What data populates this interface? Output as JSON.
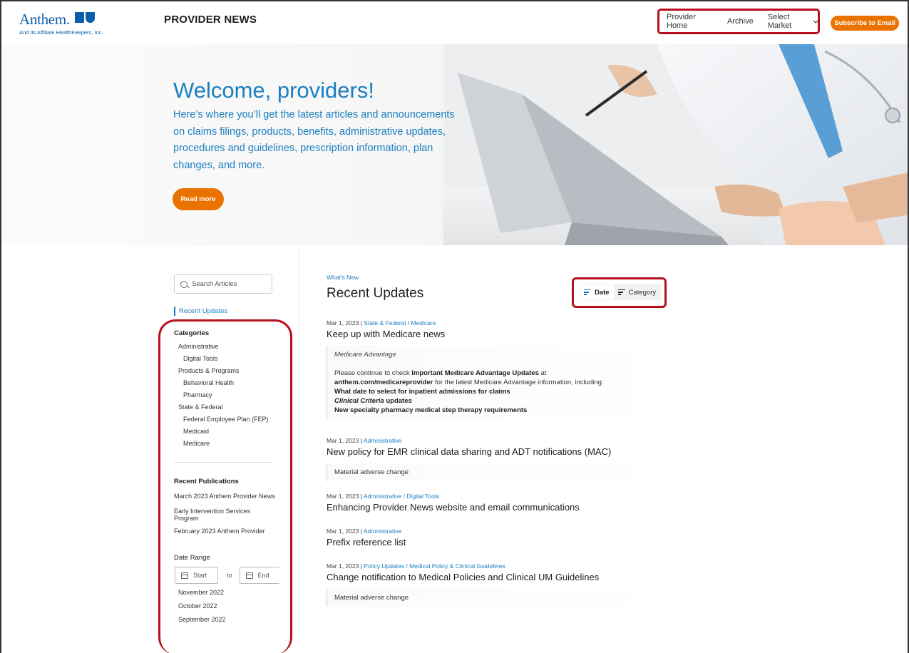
{
  "header": {
    "logo_word": "Anthem.",
    "logo_sub": "And Its Affiliate HealthKeepers, Inc.",
    "site_title": "PROVIDER NEWS",
    "nav": {
      "provider_home": "Provider Home",
      "archive": "Archive",
      "select_market": "Select Market"
    },
    "subscribe_label": "Subscribe to Email"
  },
  "hero": {
    "title": "Welcome, providers!",
    "text": "Here’s where you’ll get the latest articles and announcements on claims filings, products, benefits, administrative updates, procedures and guidelines, prescription information, plan changes, and more.",
    "read_more_label": "Read more"
  },
  "sidebar": {
    "search_placeholder": "Search Articles",
    "recent_updates_label": "Recent Updates",
    "categories_heading": "Categories",
    "categories": {
      "administrative": "Administrative",
      "digital_tools": "Digital Tools",
      "products_programs": "Products & Programs",
      "behavioral_health": "Behavioral Health",
      "pharmacy": "Pharmacy",
      "state_federal": "State & Federal",
      "fep": "Federal Employee Plan (FEP)",
      "medicaid": "Medicaid",
      "medicare": "Medicare"
    },
    "publications_heading": "Recent Publications",
    "publications": {
      "p1": "March 2023 Anthem Provider News",
      "p2_line1": "Early Intervention Services",
      "p2_line2": "Program",
      "p3": "February 2023 Anthem Provider"
    },
    "date_range_heading": "Date Range",
    "date_start": "Start",
    "date_to": "to",
    "date_end": "End",
    "months": {
      "m1": "November 2022",
      "m2": "October 2022",
      "m3": "September 2022"
    }
  },
  "main": {
    "breadcrumb": "What's New",
    "title": "Recent Updates",
    "sort": {
      "date_label": "Date",
      "category_label": "Category"
    },
    "articles": [
      {
        "date": "Mar 1, 2023 | ",
        "category": "State & Federal / Medicare",
        "title": "Keep up with Medicare news",
        "subtitle": "Medicare Advantage",
        "p1_text": "Please continue to check ",
        "p1_bold": "Important Medicare Advantage Updates",
        "p1_after": " at",
        "p2_bold": "anthem.com/medicareprovider",
        "p2_after": " for the latest Medicare Advantage information, including:",
        "b1": "What date to select for inpatient admissions for claims",
        "b2_italic": "Clinical Criteria",
        "b2_after": " updates",
        "b3": "New specialty pharmacy medical step therapy requirements"
      },
      {
        "date": "Mar 1, 2023 | ",
        "category": "Administrative",
        "title": "New policy for EMR clinical data sharing and ADT notifications (MAC)",
        "body": "Material adverse change"
      },
      {
        "date": "Mar 1, 2023 | ",
        "category": "Administrative / Digital Tools",
        "title": "Enhancing Provider News website and email communications"
      },
      {
        "date": "Mar 1, 2023 | ",
        "category": "Administrative",
        "title": "Prefix reference list"
      },
      {
        "date": "Mar 1, 2023 | ",
        "category": "Policy Updates / Medical Policy & Clinical Guidelines",
        "title": "Change notification to Medical Policies and Clinical UM Guidelines",
        "body": "Material adverse change"
      }
    ]
  },
  "colors": {
    "brand_blue": "#1a7fc1",
    "accent_orange": "#e97200",
    "highlight_red": "#b8101c"
  }
}
